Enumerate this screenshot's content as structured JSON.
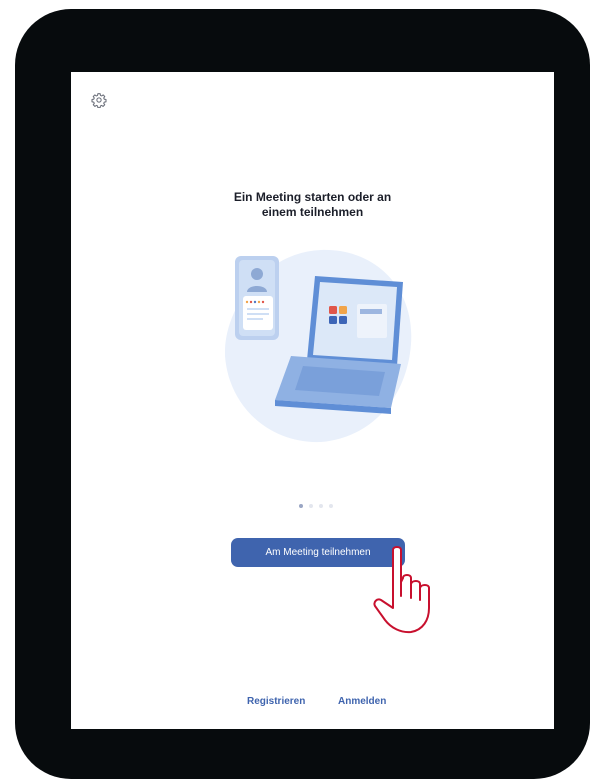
{
  "screen": {
    "title_line1": "Ein Meeting starten oder an",
    "title_line2": "einem teilnehmen",
    "carousel": {
      "page_count": 4,
      "current_page": 1
    },
    "primary_button_label": "Am Meeting teilnehmen",
    "register_label": "Registrieren",
    "login_label": "Anmelden"
  },
  "icons": {
    "settings": "gear-icon",
    "pointer": "hand-pointer-icon"
  },
  "colors": {
    "accent": "#3f64ae",
    "device_frame": "#070b0d",
    "title_text": "#1c1f2a",
    "hand_outline": "#c8102e"
  }
}
